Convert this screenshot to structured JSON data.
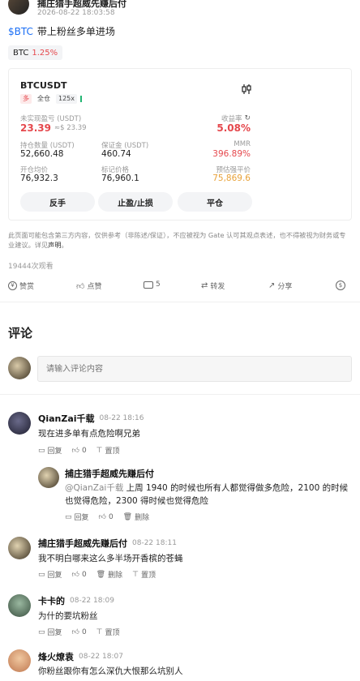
{
  "post": {
    "author": "捕庄猎手超威先赚后付",
    "timestamp": "2026-08-22 18:03:58",
    "ticker_link": "$BTC",
    "body": "带上粉丝多单进场",
    "coin_chip": {
      "symbol": "BTC",
      "change": "1.25%"
    }
  },
  "position_card": {
    "pair": "BTCUSDT",
    "side_tag": "多",
    "margin_tag": "全仓",
    "leverage_tag": "125x",
    "unrealized_pnl_label": "未实现盈亏 (USDT)",
    "unrealized_pnl_value": "23.39",
    "unrealized_pnl_approx": "≈$ 23.39",
    "roi_label": "收益率",
    "roi_value": "5.08%",
    "size_label": "持仓数量 (USDT)",
    "size_value": "52,660.48",
    "margin_label": "保证金 (USDT)",
    "margin_value": "460.74",
    "mmr_label": "MMR",
    "mmr_value": "396.89%",
    "entry_label": "开仓均价",
    "entry_value": "76,932.3",
    "mark_label": "标记价格",
    "mark_value": "76,960.1",
    "liq_label": "预估强平价",
    "liq_value": "75,869.6",
    "buttons": {
      "reverse": "反手",
      "tpsl": "止盈/止损",
      "close": "平仓"
    }
  },
  "disclaimer": {
    "text": "此页面可能包含第三方内容，仅供参考（非陈述/保证），不应被视为 Gate 认可其观点表述，也不得被视为财务或专业建议。详见",
    "link": "声明",
    "end": "。"
  },
  "views": "19444次观看",
  "actions": {
    "tip": "赞赏",
    "like": "点赞",
    "comment_count": "5",
    "repost": "转发",
    "share": "分享"
  },
  "comments_section": {
    "title": "评论",
    "input_placeholder": "请输入评论内容"
  },
  "comments": [
    {
      "name": "QianZai千载",
      "time": "08-22 18:16",
      "text": "现在进多单有点危险啊兄弟",
      "reply": "回复",
      "likes": "0",
      "pin": "置顶"
    },
    {
      "name": "捕庄猎手超威先赚后付",
      "time": "",
      "mention": "@QianZai千载",
      "text": " 上周 1940 的时候也所有人都觉得做多危险，2100 的时候也觉得危险，2300 得时候也觉得危险",
      "reply": "回复",
      "likes": "0",
      "delete": "删除"
    },
    {
      "name": "捕庄猎手超威先赚后付",
      "time": "08-22 18:11",
      "text": "我不明白哪来这么多半场开香槟的苍蝇",
      "reply": "回复",
      "likes": "0",
      "delete": "删除",
      "pin": "置顶"
    },
    {
      "name": "卡卡的",
      "time": "08-22 18:09",
      "text": "为什的要坑粉丝",
      "reply": "回复",
      "likes": "0",
      "pin": "置顶"
    },
    {
      "name": "烽火燎袁",
      "time": "08-22 18:07",
      "text": "你粉丝跟你有怎么深仇大恨那么坑别人"
    }
  ],
  "colors": {
    "red": "#e5484d",
    "green": "#22b573",
    "orange": "#e8a23a",
    "accent": "#1a6ef5"
  }
}
